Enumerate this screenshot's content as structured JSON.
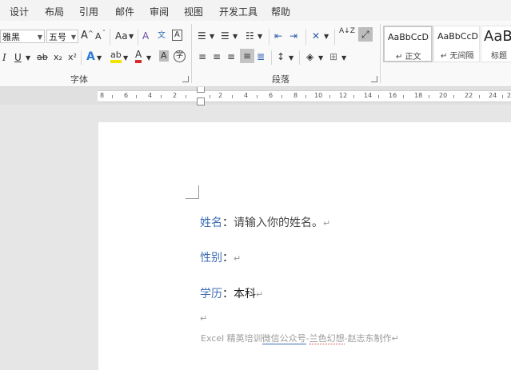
{
  "tabs": [
    "设计",
    "布局",
    "引用",
    "邮件",
    "审阅",
    "视图",
    "开发工具",
    "帮助"
  ],
  "font": {
    "name_value": "雅黑",
    "size_value": "五号",
    "grow_label": "A",
    "shrink_label": "A",
    "case_label": "Aa",
    "clear_label": "A",
    "phonetic_label": "文",
    "border_label": "A",
    "italic_label": "I",
    "underline_label": "U",
    "strike_label": "ab",
    "subscript_label": "x₂",
    "superscript_label": "x²",
    "effects_label": "A",
    "highlight_label": "ab",
    "color_label": "A",
    "shade_label": "A",
    "enclose_label": "字",
    "group_label": "字体"
  },
  "paragraph": {
    "sort_label": "A↓Z",
    "group_label": "段落"
  },
  "styles": [
    {
      "sample": "AaBbCcD",
      "name": "↵ 正文"
    },
    {
      "sample": "AaBbCcD",
      "name": "↵ 无间隔"
    },
    {
      "sample": "AaB",
      "name": "标题"
    }
  ],
  "ruler": {
    "labels": [
      "8",
      "6",
      "4",
      "2",
      "",
      "2",
      "4",
      "6",
      "8",
      "10",
      "12",
      "14",
      "16",
      "18",
      "20",
      "22",
      "24",
      "2"
    ]
  },
  "document": {
    "line1_label": "姓名",
    "line1_colon": "：",
    "line1_value": "请输入你的姓名。",
    "line2_label": "性别",
    "line2_colon": "：",
    "line2_value": "",
    "line3_label": "学历",
    "line3_colon": "：",
    "line3_value": "本科",
    "para_mark": "↵",
    "footer_a": "Excel 精英培训",
    "footer_b": "微信公众号",
    "footer_c": "-",
    "footer_d": "兰色幻想",
    "footer_e": "-赵志东制作↵"
  }
}
